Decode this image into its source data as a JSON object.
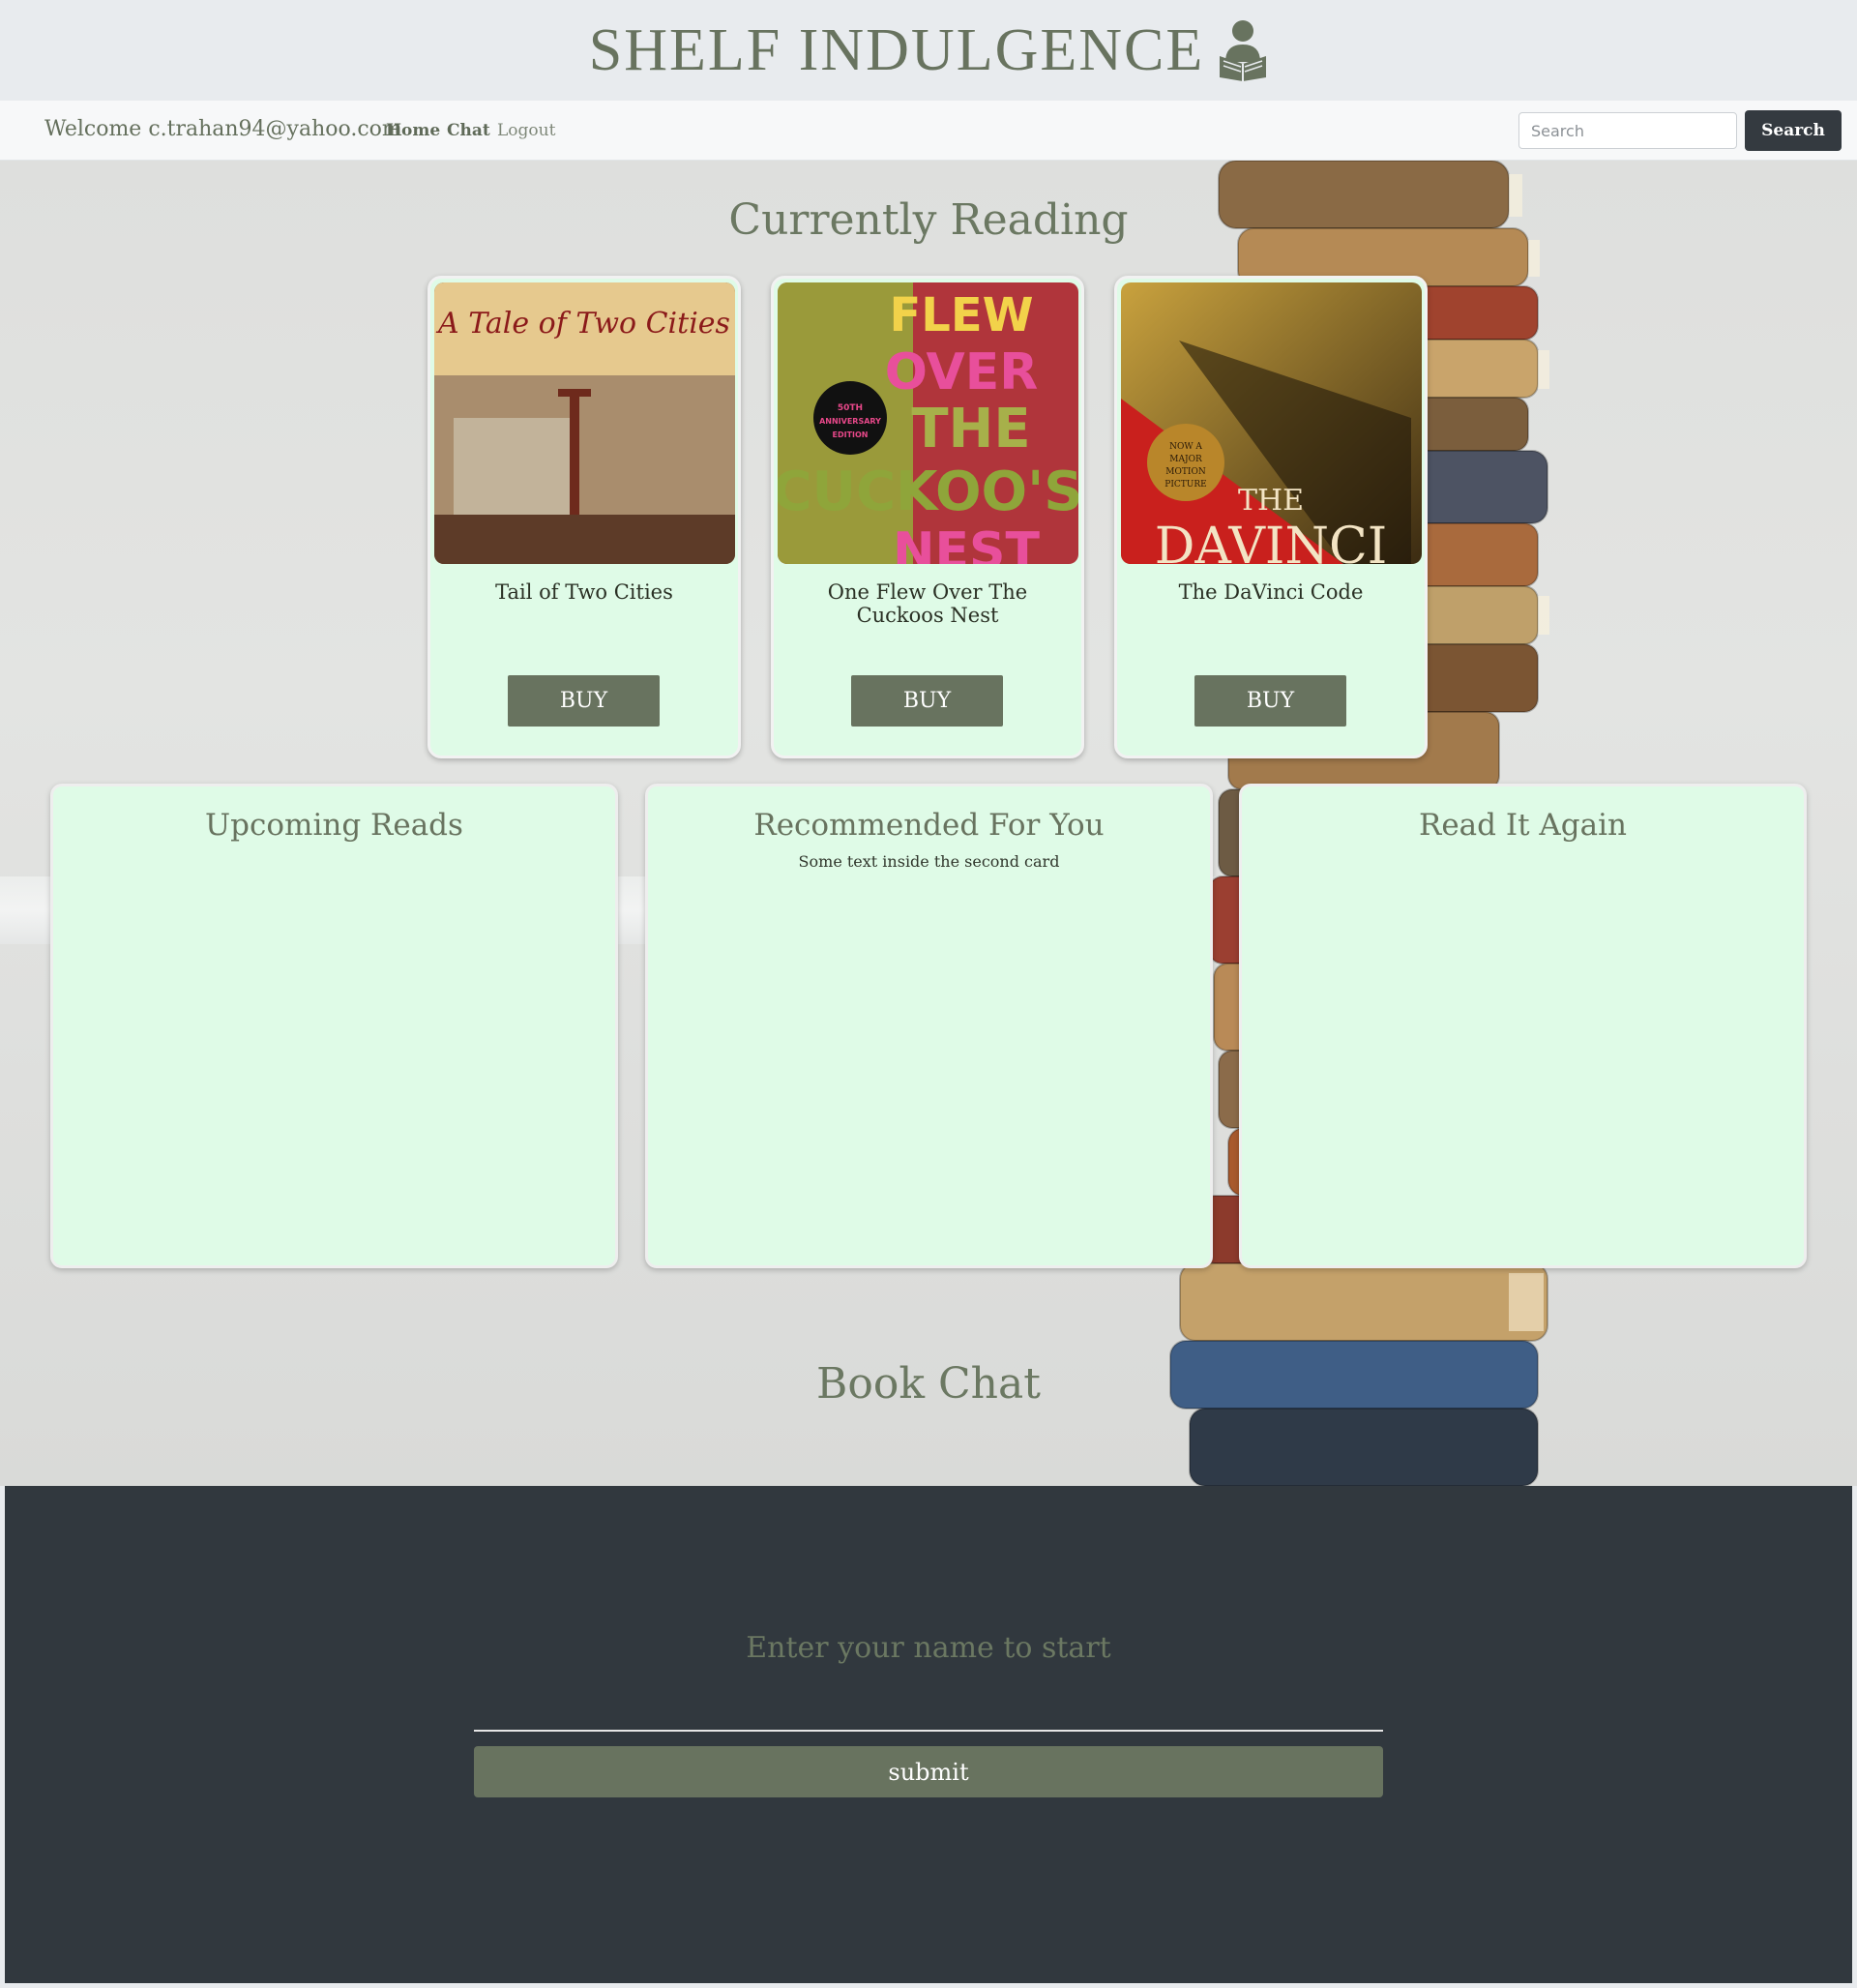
{
  "header": {
    "title": "SHELF INDULGENCE",
    "logo_icon": "reader-with-book-icon"
  },
  "nav": {
    "welcome": "Welcome c.trahan94@yahoo.com",
    "links": [
      "Home",
      "Chat",
      "Logout"
    ],
    "search_placeholder": "Search",
    "search_button": "Search"
  },
  "currently_reading": {
    "heading": "Currently Reading",
    "books": [
      {
        "title": "Tail of Two Cities",
        "cover_text": "A Tale of Two Cities",
        "buy_label": "BUY"
      },
      {
        "title": "One Flew Over The Cuckoos Nest",
        "cover_text": "FLEW OVER THE CUCKOO'S NEST",
        "cover_badge": "50TH ANNIVERSARY EDITION",
        "buy_label": "BUY"
      },
      {
        "title": "The DaVinci Code",
        "cover_text": "THE DAVINCI",
        "cover_badge": "NOW A MAJOR MOTION PICTURE",
        "buy_label": "BUY"
      }
    ]
  },
  "cards": [
    {
      "title": "Upcoming Reads",
      "text": ""
    },
    {
      "title": "Recommended For You",
      "text": "Some text inside the second card"
    },
    {
      "title": "Read It Again",
      "text": ""
    }
  ],
  "book_chat": {
    "heading": "Book Chat",
    "prompt": "Enter your name to start",
    "submit_label": "submit"
  },
  "colors": {
    "accent": "#68735f",
    "card_bg": "#dffbe7",
    "dark": "#343a40",
    "footer_bg": "#31383e"
  }
}
